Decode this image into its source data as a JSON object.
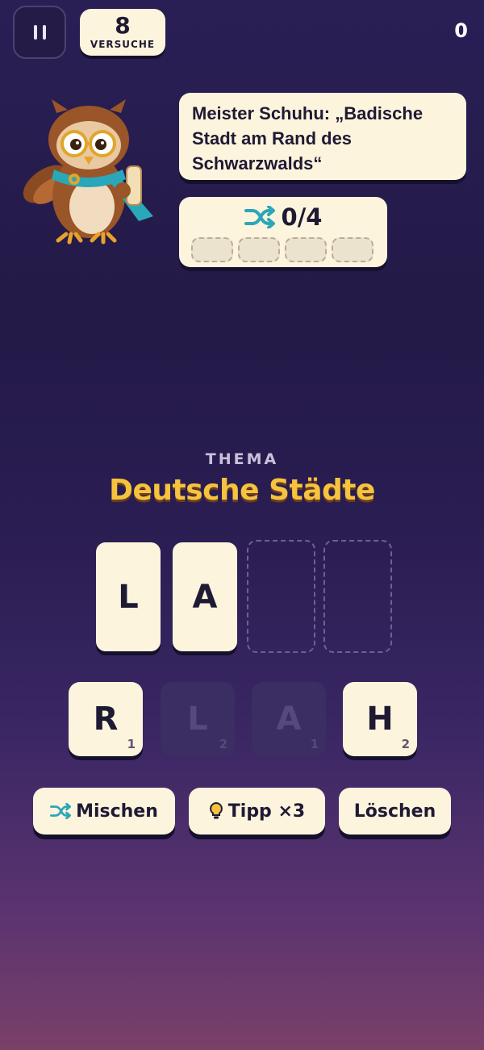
{
  "header": {
    "attempts": "8",
    "attempts_label": "VERSUCHE",
    "score": "0"
  },
  "hint_speech": "Meister Schuhu: „Badische Stadt am Rand des Schwarzwalds“",
  "progress": {
    "text": "0/4",
    "found": 0,
    "total": 4
  },
  "theme": {
    "label": "THEMA",
    "title": "Deutsche Städte"
  },
  "answer_slots": [
    "L",
    "A",
    "",
    ""
  ],
  "letter_pool": [
    {
      "letter": "R",
      "points": "1",
      "used": false
    },
    {
      "letter": "L",
      "points": "2",
      "used": true
    },
    {
      "letter": "A",
      "points": "1",
      "used": true
    },
    {
      "letter": "H",
      "points": "2",
      "used": false
    }
  ],
  "actions": {
    "shuffle": "Mischen",
    "hint": "Tipp ×3",
    "delete": "Löschen"
  },
  "colors": {
    "tile": "#fdf4dd",
    "title_accent": "#f6c33e",
    "icon_teal": "#2aa7b8"
  }
}
